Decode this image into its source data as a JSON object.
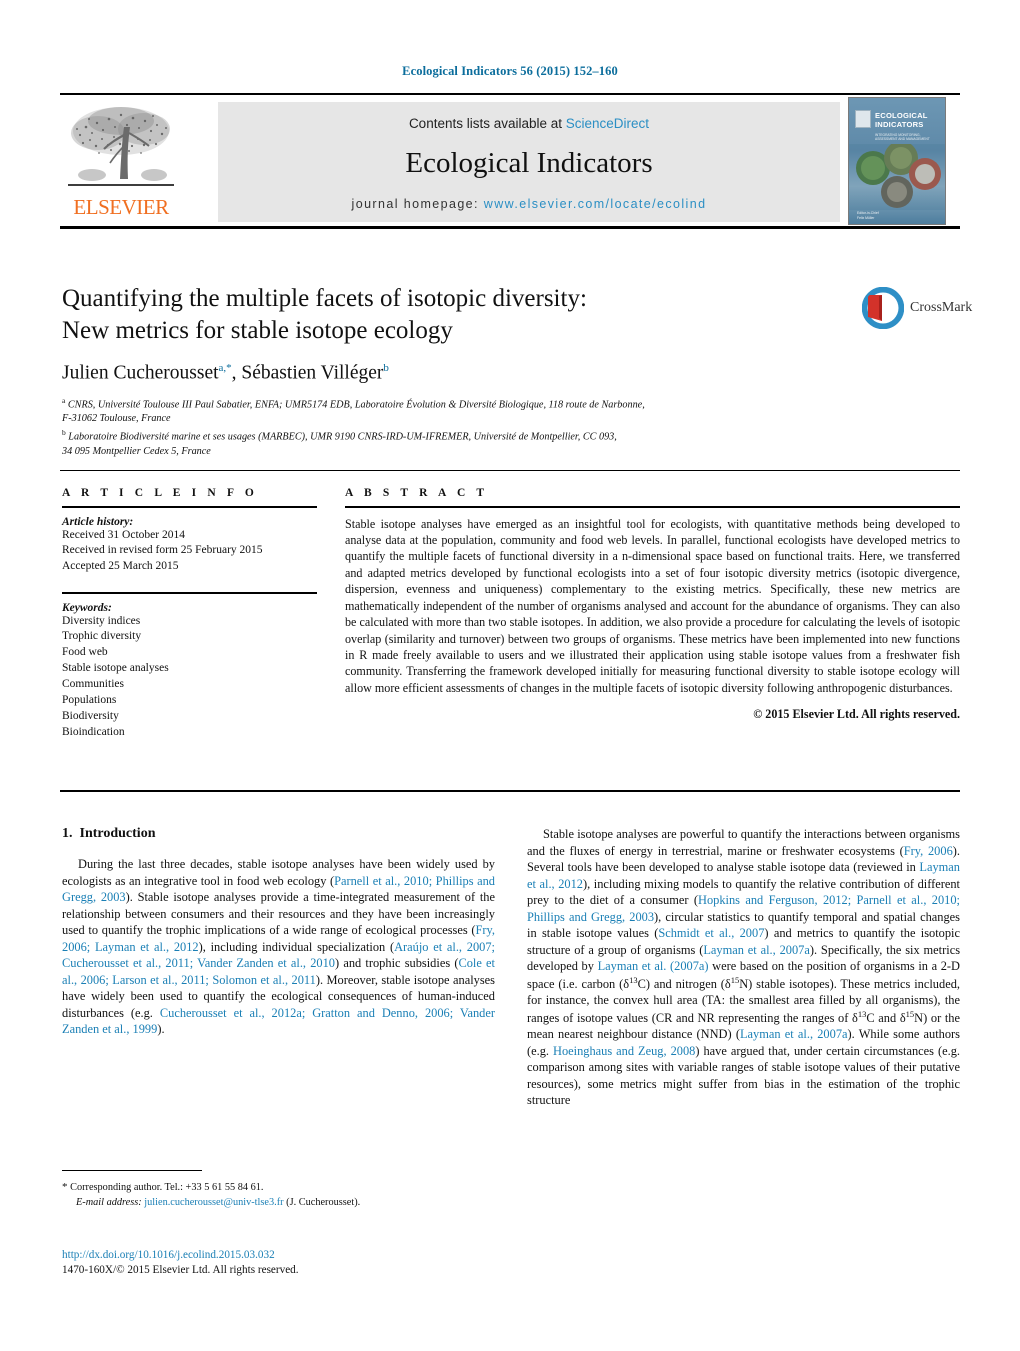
{
  "running_head": "Ecological Indicators 56 (2015) 152–160",
  "masthead": {
    "contents_prefix": "Contents lists available at ",
    "sciencedirect": "ScienceDirect",
    "journal_name": "Ecological Indicators",
    "homepage_prefix": "journal homepage: ",
    "homepage_url": "www.elsevier.com/locate/ecolind",
    "publisher": "ELSEVIER",
    "cover": {
      "title_line1": "ECOLOGICAL",
      "title_line2": "INDICATORS",
      "subtitle": "INTEGRATING MONITORING, ASSESSMENT AND MANAGEMENT",
      "footer_line1": "Editor-in-Chief",
      "footer_line2": "Felix Müller"
    }
  },
  "crossmark": {
    "label": "CrossMark"
  },
  "article": {
    "title_line1": "Quantifying the multiple facets of isotopic diversity:",
    "title_line2": "New metrics for stable isotope ecology",
    "authors": [
      {
        "name": "Julien Cucherousset",
        "sup": "a,*"
      },
      {
        "name": "Sébastien Villéger",
        "sup": "b"
      }
    ],
    "authors_separator": ", ",
    "affiliations": [
      {
        "marker": "a",
        "line1": "CNRS, Université Toulouse III Paul Sabatier, ENFA; UMR5174 EDB, Laboratoire Évolution & Diversité Biologique, 118 route de Narbonne,",
        "line2": "F-31062 Toulouse, France"
      },
      {
        "marker": "b",
        "line1": "Laboratoire Biodiversité marine et ses usages (MARBEC), UMR 9190 CNRS-IRD-UM-IFREMER, Université de Montpellier, CC 093,",
        "line2": "34 095 Montpellier Cedex 5, France"
      }
    ]
  },
  "article_info": {
    "heading": "A R T I C L E   I N F O",
    "history_label": "Article history:",
    "history": [
      "Received 31 October 2014",
      "Received in revised form 25 February 2015",
      "Accepted 25 March 2015"
    ],
    "keywords_label": "Keywords:",
    "keywords": [
      "Diversity indices",
      "Trophic diversity",
      "Food web",
      "Stable isotope analyses",
      "Communities",
      "Populations",
      "Biodiversity",
      "Bioindication"
    ]
  },
  "abstract": {
    "heading": "A B S T R A C T",
    "text": "Stable isotope analyses have emerged as an insightful tool for ecologists, with quantitative methods being developed to analyse data at the population, community and food web levels. In parallel, functional ecologists have developed metrics to quantify the multiple facets of functional diversity in a n-dimensional space based on functional traits. Here, we transferred and adapted metrics developed by functional ecologists into a set of four isotopic diversity metrics (isotopic divergence, dispersion, evenness and uniqueness) complementary to the existing metrics. Specifically, these new metrics are mathematically independent of the number of organisms analysed and account for the abundance of organisms. They can also be calculated with more than two stable isotopes. In addition, we also provide a procedure for calculating the levels of isotopic overlap (similarity and turnover) between two groups of organisms. These metrics have been implemented into new functions in R made freely available to users and we illustrated their application using stable isotope values from a freshwater fish community. Transferring the framework developed initially for measuring functional diversity to stable isotope ecology will allow more efficient assessments of changes in the multiple facets of isotopic diversity following anthropogenic disturbances.",
    "copyright": "© 2015 Elsevier Ltd. All rights reserved."
  },
  "introduction": {
    "number": "1.",
    "heading": "Introduction",
    "left_paragraph_1_a": "During the last three decades, stable isotope analyses have been widely used by ecologists as an integrative tool in food web ecology (",
    "left_ref_1": "Parnell et al., 2010; Phillips and Gregg, 2003",
    "left_paragraph_1_b": "). Stable isotope analyses provide a time-integrated measurement of the relationship between consumers and their resources and they have been increasingly used to quantify the trophic implications of a wide range of ecological processes (",
    "left_ref_2": "Fry, 2006; Layman et al., 2012",
    "left_paragraph_1_c": "), including individual specialization (",
    "left_ref_3": "Araújo et al., 2007; Cucherousset et al., 2011; Vander Zanden et al., 2010",
    "left_paragraph_1_d": ") and trophic subsidies (",
    "left_ref_4": "Cole et al., 2006; Larson et al., 2011; Solomon et al., 2011",
    "left_paragraph_1_e": "). Moreover, stable isotope analyses have widely been used to quantify the ecological consequences of human-induced disturbances (e.g. ",
    "left_ref_5": "Cucherousset et al., 2012a; Gratton and Denno, 2006; Vander Zanden et al., 1999",
    "left_paragraph_1_f": ").",
    "right_paragraph_1_a": "Stable isotope analyses are powerful to quantify the interactions between organisms and the fluxes of energy in terrestrial, marine or freshwater ecosystems (",
    "right_ref_1": "Fry, 2006",
    "right_paragraph_1_b": "). Several tools have been developed to analyse stable isotope data (reviewed in ",
    "right_ref_2": "Layman et al., 2012",
    "right_paragraph_1_c": "), including mixing models to quantify the relative contribution of different prey to the diet of a consumer (",
    "right_ref_3": "Hopkins and Ferguson, 2012; Parnell et al., 2010; Phillips and Gregg, 2003",
    "right_paragraph_1_d": "), circular statistics to quantify temporal and spatial changes in stable isotope values (",
    "right_ref_4": "Schmidt et al., 2007",
    "right_paragraph_1_e": ") and metrics to quantify the isotopic structure of a group of organisms (",
    "right_ref_5": "Layman et al., 2007a",
    "right_paragraph_1_f": "). Specifically, the six metrics developed by ",
    "right_ref_6": "Layman et al. (2007a)",
    "right_paragraph_1_g": " were based on the position of organisms in a 2-D space (i.e. carbon (δ",
    "sup_13": "13",
    "right_paragraph_1_h": "C) and nitrogen (δ",
    "sup_15": "15",
    "right_paragraph_1_i": "N) stable isotopes). These metrics included, for instance, the convex hull area (TA: the smallest area filled by all organisms), the ranges of isotope values (CR and NR representing the ranges of δ",
    "right_paragraph_1_j": "C and δ",
    "right_paragraph_1_k": "N) or the mean nearest neighbour distance (NND) (",
    "right_ref_7": "Layman et al., 2007a",
    "right_paragraph_1_l": "). While some authors (e.g. ",
    "right_ref_8": "Hoeinghaus and Zeug, 2008",
    "right_paragraph_1_m": ") have argued that, under certain circumstances (e.g. comparison among sites with variable ranges of stable isotope values of their putative resources), some metrics might suffer from bias in the estimation of the trophic structure"
  },
  "footnote": {
    "star": "*",
    "corresponding": " Corresponding author. Tel.: +33 5 61 55 84 61.",
    "email_label": "E-mail address:",
    "email": "julien.cucherousset@univ-tlse3.fr",
    "email_suffix": " (J. Cucherousset).",
    "doi": "http://dx.doi.org/10.1016/j.ecolind.2015.03.032",
    "issn_line": "1470-160X/© 2015 Elsevier Ltd. All rights reserved."
  },
  "colors": {
    "link": "#1a7fb5",
    "running_head": "#0b6d9c",
    "sciencedirect": "#2b8fc4",
    "elsevier_orange": "#f06f21",
    "masthead_bg": "#e6e6e6"
  }
}
